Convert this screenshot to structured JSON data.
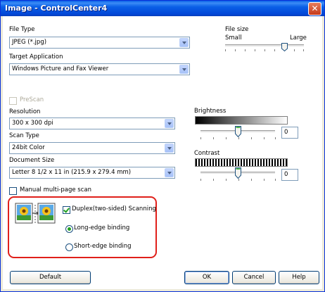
{
  "window": {
    "title": "Image - ControlCenter4",
    "close_icon": "close-icon"
  },
  "file_type": {
    "label": "File Type",
    "value": "JPEG (*.jpg)"
  },
  "file_size": {
    "label": "File size",
    "small": "Small",
    "large": "Large",
    "level": 0.75
  },
  "target_application": {
    "label": "Target Application",
    "value": "Windows Picture and Fax Viewer"
  },
  "prescan": {
    "label": "PreScan",
    "checked": false,
    "enabled": false
  },
  "resolution": {
    "label": "Resolution",
    "value": "300 x 300 dpi"
  },
  "scan_type": {
    "label": "Scan Type",
    "value": "24bit Color"
  },
  "document_size": {
    "label": "Document Size",
    "value": "Letter 8 1/2 x 11 in (215.9 x 279.4 mm)"
  },
  "brightness": {
    "label": "Brightness",
    "value": "0",
    "level": 0.5
  },
  "contrast": {
    "label": "Contrast",
    "value": "0",
    "level": 0.5
  },
  "manual_multipage": {
    "label": "Manual multi-page scan",
    "checked": false
  },
  "duplex": {
    "label": "Duplex(two-sided) Scanning",
    "checked": true,
    "long_edge": {
      "label": "Long-edge binding",
      "selected": true
    },
    "short_edge": {
      "label": "Short-edge binding",
      "selected": false
    },
    "icon": "duplex-flower-pages-icon"
  },
  "buttons": {
    "default": "Default",
    "ok": "OK",
    "cancel": "Cancel",
    "help": "Help"
  },
  "colors": {
    "title_bar": "#0a5fe6",
    "highlight_border": "#e0201a",
    "checkmark": "#21a121"
  }
}
